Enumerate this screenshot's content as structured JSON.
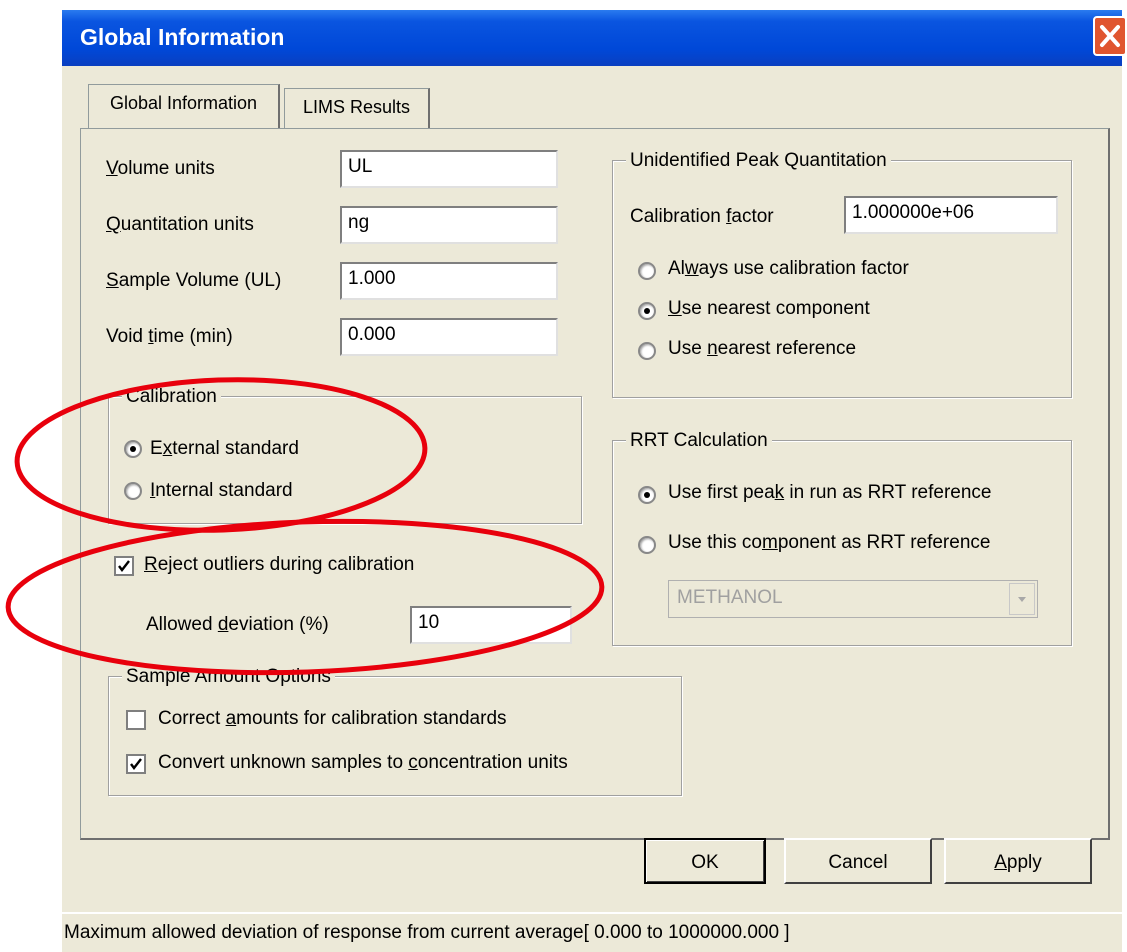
{
  "window": {
    "title": "Global Information"
  },
  "tabs": [
    {
      "label": "Global Information"
    },
    {
      "label": "LIMS Results"
    }
  ],
  "fields": {
    "volume_units": {
      "label_pre": "",
      "label_key": "V",
      "label_post": "olume units",
      "value": "UL"
    },
    "quantitation_units": {
      "label_pre": "",
      "label_key": "Q",
      "label_post": "uantitation units",
      "value": "ng"
    },
    "sample_volume": {
      "label_pre": "",
      "label_key": "S",
      "label_post": "ample Volume (UL)",
      "value": "1.000"
    },
    "void_time": {
      "label_pre": "Void ",
      "label_key": "t",
      "label_post": "ime (min)",
      "value": "0.000"
    }
  },
  "calibration": {
    "title": "Calibration",
    "external": {
      "pre": "E",
      "key": "x",
      "post": "ternal standard",
      "selected": true
    },
    "internal": {
      "pre": "",
      "key": "I",
      "post": "nternal standard",
      "selected": false
    }
  },
  "reject_outliers": {
    "pre": "",
    "key": "R",
    "post": "eject outliers during calibration",
    "checked": true,
    "deviation_label_pre": "Allowed ",
    "deviation_label_key": "d",
    "deviation_label_post": "eviation (%)",
    "deviation_value": "10"
  },
  "sample_amount": {
    "title": "Sample Amount Options",
    "correct": {
      "pre": "Correct ",
      "key": "a",
      "post": "mounts for calibration standards",
      "checked": false
    },
    "convert": {
      "pre": "Convert unknown samples to ",
      "key": "c",
      "post": "oncentration units",
      "checked": true
    }
  },
  "unidentified": {
    "title": "Unidentified Peak Quantitation",
    "cal_factor_label_pre": "Calibration ",
    "cal_factor_label_key": "f",
    "cal_factor_label_post": "actor",
    "cal_factor_value": "1.000000e+06",
    "always": {
      "pre": "Al",
      "key": "w",
      "post": "ays use calibration factor",
      "selected": false
    },
    "nearest_component": {
      "pre": "",
      "key": "U",
      "post": "se nearest component",
      "selected": true
    },
    "nearest_reference": {
      "pre": "Use ",
      "key": "n",
      "post": "earest reference",
      "selected": false
    }
  },
  "rrt": {
    "title": "RRT Calculation",
    "first_peak": {
      "pre": "Use first pea",
      "key": "k",
      "post": " in run as RRT reference",
      "selected": true
    },
    "this_component": {
      "pre": "Use this co",
      "key": "m",
      "post": "ponent as RRT reference",
      "selected": false
    },
    "component_select": "METHANOL"
  },
  "buttons": {
    "ok": "OK",
    "cancel": "Cancel",
    "apply_key": "A",
    "apply_post": "pply"
  },
  "status": "Maximum allowed deviation of response from current average[ 0.000 to 1000000.000 ]",
  "colors": {
    "titlebar": "#0a55e0",
    "dialog_bg": "#ece9d8",
    "annotation": "#e8000c"
  }
}
